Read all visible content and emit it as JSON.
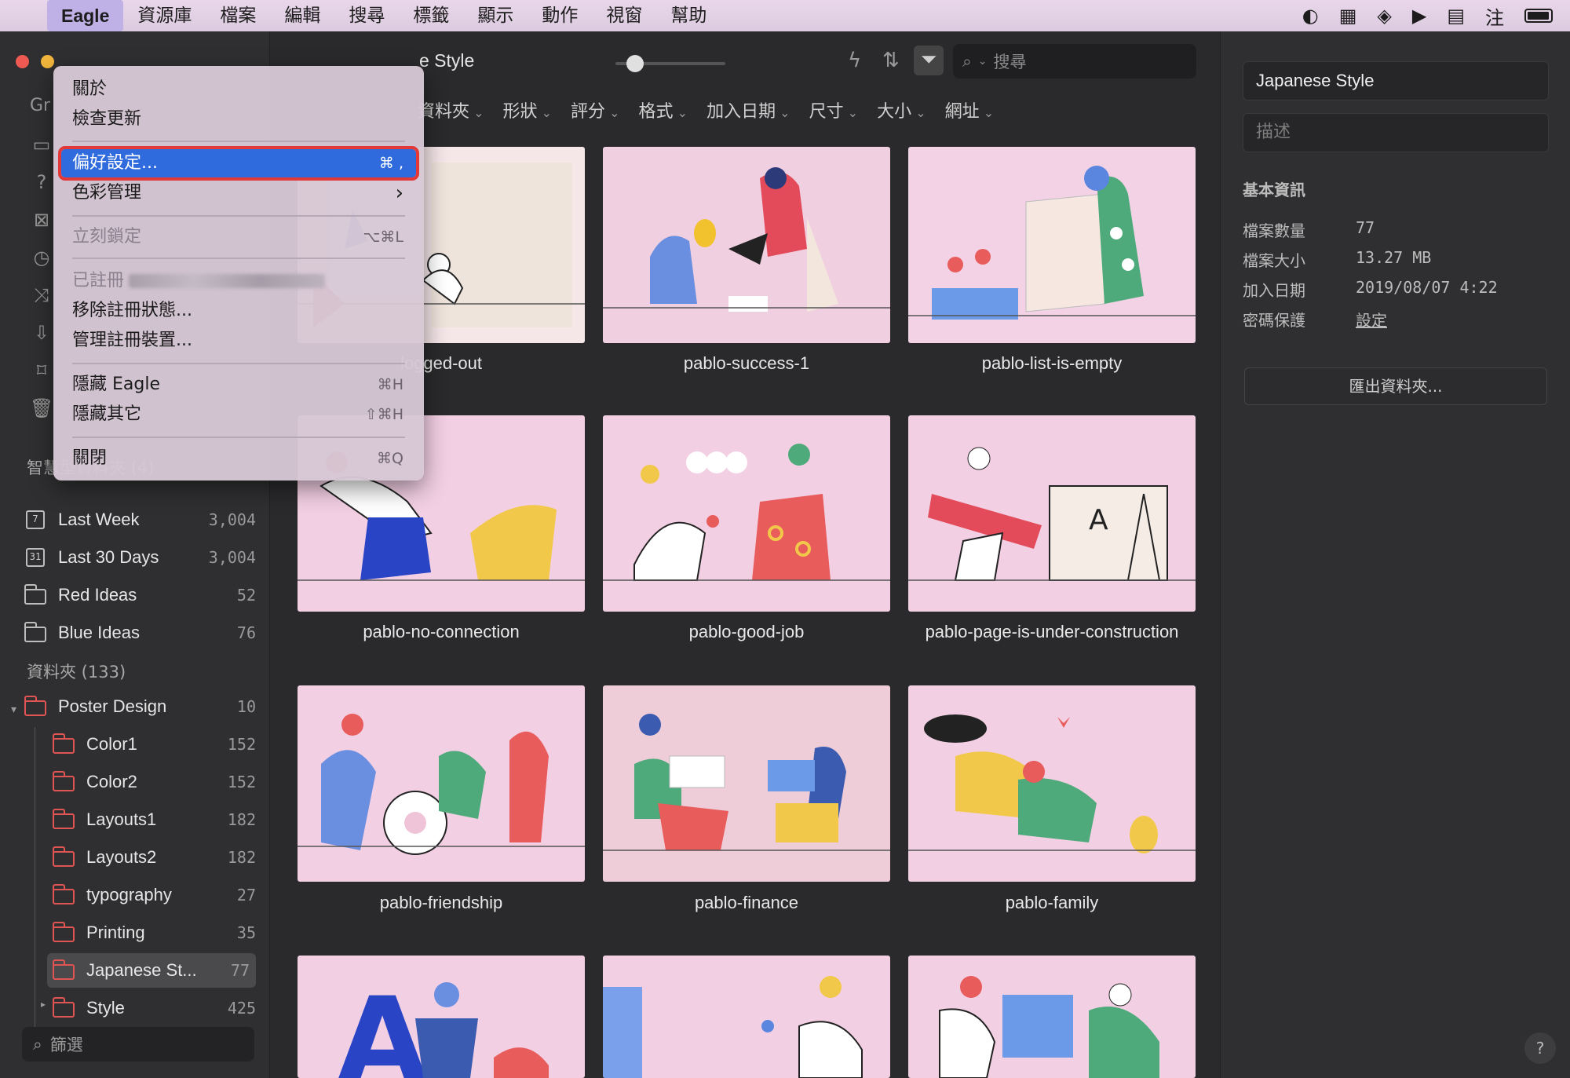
{
  "menubar": {
    "apple": "",
    "items": [
      "Eagle",
      "資源庫",
      "檔案",
      "編輯",
      "搜尋",
      "標籤",
      "顯示",
      "動作",
      "視窗",
      "幫助"
    ],
    "status_icons": [
      "eagle-status-icon",
      "bookmark-grid-icon",
      "layers-icon",
      "play-icon",
      "keyboard-icon",
      "input-method-icon",
      "battery-icon"
    ]
  },
  "dropdown": {
    "about": "關於",
    "check_updates": "檢查更新",
    "preferences": "偏好設定...",
    "preferences_sc": "⌘ ,",
    "color_mgmt": "色彩管理",
    "color_mgmt_arrow": "›",
    "lock_now": "立刻鎖定",
    "lock_now_sc": "⌥⌘L",
    "registered": "已註冊",
    "remove_reg": "移除註冊狀態...",
    "manage_devices": "管理註冊裝置...",
    "hide_eagle": "隱藏 Eagle",
    "hide_eagle_sc": "⌘H",
    "hide_others": "隱藏其它",
    "hide_others_sc": "⇧⌘H",
    "quit": "關閉",
    "quit_sc": "⌘Q"
  },
  "sidebar": {
    "group_label": "Gr",
    "smart_title": "智慧型資料夾 (4)",
    "smart": [
      {
        "icon": "7",
        "label": "Last Week",
        "count": "3,004"
      },
      {
        "icon": "31",
        "label": "Last 30 Days",
        "count": "3,004"
      },
      {
        "label": "Red Ideas",
        "count": "52"
      },
      {
        "label": "Blue Ideas",
        "count": "76"
      }
    ],
    "folders_title": "資料夾 (133)",
    "folders": [
      {
        "label": "Poster Design",
        "count": "10"
      },
      {
        "label": "Color1",
        "count": "152"
      },
      {
        "label": "Color2",
        "count": "152"
      },
      {
        "label": "Layouts1",
        "count": "182"
      },
      {
        "label": "Layouts2",
        "count": "182"
      },
      {
        "label": "typography",
        "count": "27"
      },
      {
        "label": "Printing",
        "count": "35"
      },
      {
        "label": "Japanese St...",
        "count": "77"
      },
      {
        "label": "Style",
        "count": "425"
      }
    ],
    "filter_placeholder": "篩選"
  },
  "toolbar": {
    "title": "e Style",
    "search_placeholder": "搜尋",
    "filters": [
      "資料夾",
      "形狀",
      "評分",
      "格式",
      "加入日期",
      "尺寸",
      "大小",
      "網址"
    ]
  },
  "grid": {
    "items": [
      {
        "caption": "logged-out",
        "bg": "#f5e6e8"
      },
      {
        "caption": "pablo-success-1",
        "bg": "#f0cfe0"
      },
      {
        "caption": "pablo-list-is-empty",
        "bg": "#f3d2e6"
      },
      {
        "caption": "pablo-no-connection",
        "bg": "#f4d4e7"
      },
      {
        "caption": "pablo-good-job",
        "bg": "#f4d4e7"
      },
      {
        "caption": "pablo-page-is-under-construction",
        "bg": "#f4d4e7"
      },
      {
        "caption": "pablo-friendship",
        "bg": "#f4d4e7"
      },
      {
        "caption": "pablo-finance",
        "bg": "#eecdd8"
      },
      {
        "caption": "pablo-family",
        "bg": "#f4d4e7"
      },
      {
        "caption": "",
        "bg": "#f4d4e7"
      },
      {
        "caption": "",
        "bg": "#f4d4e7"
      },
      {
        "caption": "",
        "bg": "#f4d4e7"
      }
    ]
  },
  "inspector": {
    "name": "Japanese Style",
    "desc_placeholder": "描述",
    "section": "基本資訊",
    "rows": [
      {
        "k": "檔案數量",
        "v": "77"
      },
      {
        "k": "檔案大小",
        "v": "13.27 MB"
      },
      {
        "k": "加入日期",
        "v": "2019/08/07 4:22"
      },
      {
        "k": "密碼保護",
        "v": "設定"
      }
    ],
    "export": "匯出資料夾...",
    "help": "?"
  },
  "colors": {
    "accent": "#2f6bdc",
    "highlight_outline": "#e23838",
    "folder": "#e05454"
  }
}
